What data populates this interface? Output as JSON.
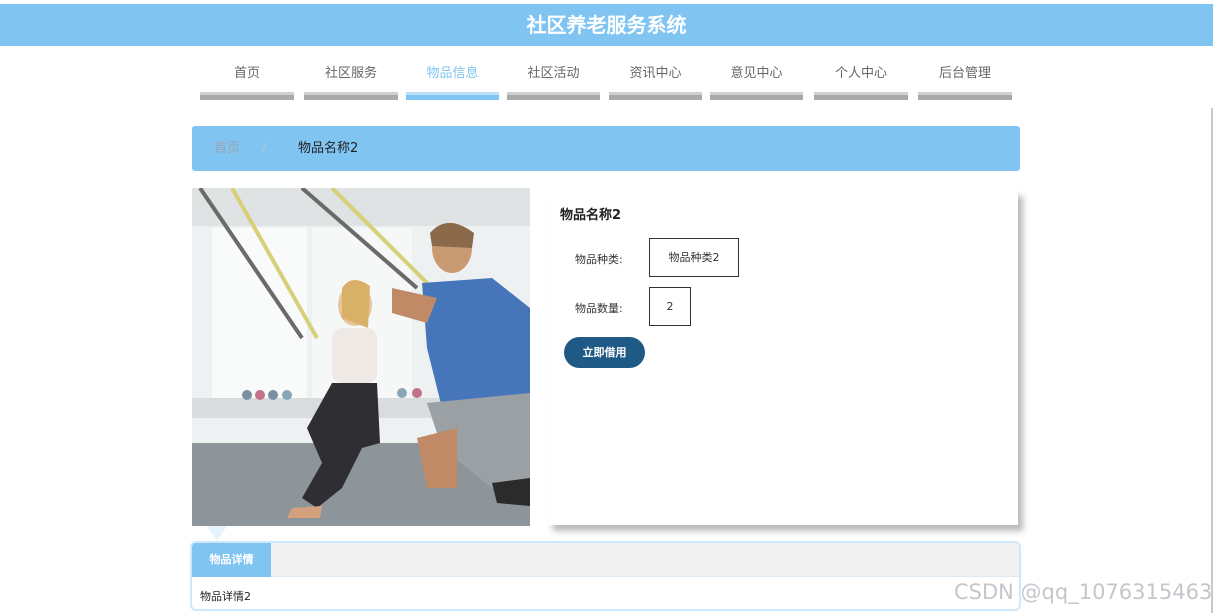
{
  "header": {
    "title": "社区养老服务系统"
  },
  "nav": {
    "items": [
      {
        "label": "首页"
      },
      {
        "label": "社区服务"
      },
      {
        "label": "物品信息"
      },
      {
        "label": "社区活动"
      },
      {
        "label": "资讯中心"
      },
      {
        "label": "意见中心"
      },
      {
        "label": "个人中心"
      },
      {
        "label": "后台管理"
      }
    ],
    "active_index": 2
  },
  "breadcrumb": {
    "home": "首页",
    "separator": "/",
    "current": "物品名称2"
  },
  "product": {
    "name": "物品名称2",
    "category_label": "物品种类:",
    "category_value": "物品种类2",
    "quantity_label": "物品数量:",
    "quantity_value": "2",
    "borrow_button": "立即借用"
  },
  "details": {
    "tab_label": "物品详情",
    "content": "物品详情2"
  },
  "watermark": "CSDN @qq_1076315463",
  "colors": {
    "accent": "#80c4f2",
    "button": "#1f5a86",
    "nav_bar": "#a9a9a9"
  }
}
